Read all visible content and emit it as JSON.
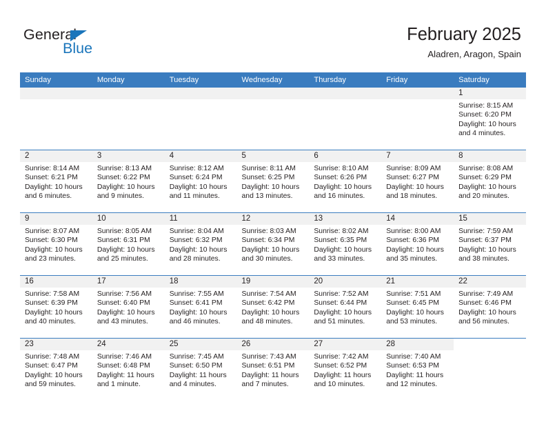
{
  "brand": {
    "name_part1": "General",
    "name_part2": "Blue"
  },
  "header": {
    "month_title": "February 2025",
    "location": "Aladren, Aragon, Spain"
  },
  "colors": {
    "header_blue": "#3a7cbf",
    "logo_blue": "#1a75bb",
    "daystrip_gray": "#f1f1f1",
    "text": "#231f20"
  },
  "weekdays": [
    "Sunday",
    "Monday",
    "Tuesday",
    "Wednesday",
    "Thursday",
    "Friday",
    "Saturday"
  ],
  "weeks": [
    [
      {
        "day": "",
        "sunrise": "",
        "sunset": "",
        "daylight_line1": "",
        "daylight_line2": "",
        "blank": true
      },
      {
        "day": "",
        "sunrise": "",
        "sunset": "",
        "daylight_line1": "",
        "daylight_line2": "",
        "blank": true
      },
      {
        "day": "",
        "sunrise": "",
        "sunset": "",
        "daylight_line1": "",
        "daylight_line2": "",
        "blank": true
      },
      {
        "day": "",
        "sunrise": "",
        "sunset": "",
        "daylight_line1": "",
        "daylight_line2": "",
        "blank": true
      },
      {
        "day": "",
        "sunrise": "",
        "sunset": "",
        "daylight_line1": "",
        "daylight_line2": "",
        "blank": true
      },
      {
        "day": "",
        "sunrise": "",
        "sunset": "",
        "daylight_line1": "",
        "daylight_line2": "",
        "blank": true
      },
      {
        "day": "1",
        "sunrise": "Sunrise: 8:15 AM",
        "sunset": "Sunset: 6:20 PM",
        "daylight_line1": "Daylight: 10 hours",
        "daylight_line2": "and 4 minutes."
      }
    ],
    [
      {
        "day": "2",
        "sunrise": "Sunrise: 8:14 AM",
        "sunset": "Sunset: 6:21 PM",
        "daylight_line1": "Daylight: 10 hours",
        "daylight_line2": "and 6 minutes."
      },
      {
        "day": "3",
        "sunrise": "Sunrise: 8:13 AM",
        "sunset": "Sunset: 6:22 PM",
        "daylight_line1": "Daylight: 10 hours",
        "daylight_line2": "and 9 minutes."
      },
      {
        "day": "4",
        "sunrise": "Sunrise: 8:12 AM",
        "sunset": "Sunset: 6:24 PM",
        "daylight_line1": "Daylight: 10 hours",
        "daylight_line2": "and 11 minutes."
      },
      {
        "day": "5",
        "sunrise": "Sunrise: 8:11 AM",
        "sunset": "Sunset: 6:25 PM",
        "daylight_line1": "Daylight: 10 hours",
        "daylight_line2": "and 13 minutes."
      },
      {
        "day": "6",
        "sunrise": "Sunrise: 8:10 AM",
        "sunset": "Sunset: 6:26 PM",
        "daylight_line1": "Daylight: 10 hours",
        "daylight_line2": "and 16 minutes."
      },
      {
        "day": "7",
        "sunrise": "Sunrise: 8:09 AM",
        "sunset": "Sunset: 6:27 PM",
        "daylight_line1": "Daylight: 10 hours",
        "daylight_line2": "and 18 minutes."
      },
      {
        "day": "8",
        "sunrise": "Sunrise: 8:08 AM",
        "sunset": "Sunset: 6:29 PM",
        "daylight_line1": "Daylight: 10 hours",
        "daylight_line2": "and 20 minutes."
      }
    ],
    [
      {
        "day": "9",
        "sunrise": "Sunrise: 8:07 AM",
        "sunset": "Sunset: 6:30 PM",
        "daylight_line1": "Daylight: 10 hours",
        "daylight_line2": "and 23 minutes."
      },
      {
        "day": "10",
        "sunrise": "Sunrise: 8:05 AM",
        "sunset": "Sunset: 6:31 PM",
        "daylight_line1": "Daylight: 10 hours",
        "daylight_line2": "and 25 minutes."
      },
      {
        "day": "11",
        "sunrise": "Sunrise: 8:04 AM",
        "sunset": "Sunset: 6:32 PM",
        "daylight_line1": "Daylight: 10 hours",
        "daylight_line2": "and 28 minutes."
      },
      {
        "day": "12",
        "sunrise": "Sunrise: 8:03 AM",
        "sunset": "Sunset: 6:34 PM",
        "daylight_line1": "Daylight: 10 hours",
        "daylight_line2": "and 30 minutes."
      },
      {
        "day": "13",
        "sunrise": "Sunrise: 8:02 AM",
        "sunset": "Sunset: 6:35 PM",
        "daylight_line1": "Daylight: 10 hours",
        "daylight_line2": "and 33 minutes."
      },
      {
        "day": "14",
        "sunrise": "Sunrise: 8:00 AM",
        "sunset": "Sunset: 6:36 PM",
        "daylight_line1": "Daylight: 10 hours",
        "daylight_line2": "and 35 minutes."
      },
      {
        "day": "15",
        "sunrise": "Sunrise: 7:59 AM",
        "sunset": "Sunset: 6:37 PM",
        "daylight_line1": "Daylight: 10 hours",
        "daylight_line2": "and 38 minutes."
      }
    ],
    [
      {
        "day": "16",
        "sunrise": "Sunrise: 7:58 AM",
        "sunset": "Sunset: 6:39 PM",
        "daylight_line1": "Daylight: 10 hours",
        "daylight_line2": "and 40 minutes."
      },
      {
        "day": "17",
        "sunrise": "Sunrise: 7:56 AM",
        "sunset": "Sunset: 6:40 PM",
        "daylight_line1": "Daylight: 10 hours",
        "daylight_line2": "and 43 minutes."
      },
      {
        "day": "18",
        "sunrise": "Sunrise: 7:55 AM",
        "sunset": "Sunset: 6:41 PM",
        "daylight_line1": "Daylight: 10 hours",
        "daylight_line2": "and 46 minutes."
      },
      {
        "day": "19",
        "sunrise": "Sunrise: 7:54 AM",
        "sunset": "Sunset: 6:42 PM",
        "daylight_line1": "Daylight: 10 hours",
        "daylight_line2": "and 48 minutes."
      },
      {
        "day": "20",
        "sunrise": "Sunrise: 7:52 AM",
        "sunset": "Sunset: 6:44 PM",
        "daylight_line1": "Daylight: 10 hours",
        "daylight_line2": "and 51 minutes."
      },
      {
        "day": "21",
        "sunrise": "Sunrise: 7:51 AM",
        "sunset": "Sunset: 6:45 PM",
        "daylight_line1": "Daylight: 10 hours",
        "daylight_line2": "and 53 minutes."
      },
      {
        "day": "22",
        "sunrise": "Sunrise: 7:49 AM",
        "sunset": "Sunset: 6:46 PM",
        "daylight_line1": "Daylight: 10 hours",
        "daylight_line2": "and 56 minutes."
      }
    ],
    [
      {
        "day": "23",
        "sunrise": "Sunrise: 7:48 AM",
        "sunset": "Sunset: 6:47 PM",
        "daylight_line1": "Daylight: 10 hours",
        "daylight_line2": "and 59 minutes."
      },
      {
        "day": "24",
        "sunrise": "Sunrise: 7:46 AM",
        "sunset": "Sunset: 6:48 PM",
        "daylight_line1": "Daylight: 11 hours",
        "daylight_line2": "and 1 minute."
      },
      {
        "day": "25",
        "sunrise": "Sunrise: 7:45 AM",
        "sunset": "Sunset: 6:50 PM",
        "daylight_line1": "Daylight: 11 hours",
        "daylight_line2": "and 4 minutes."
      },
      {
        "day": "26",
        "sunrise": "Sunrise: 7:43 AM",
        "sunset": "Sunset: 6:51 PM",
        "daylight_line1": "Daylight: 11 hours",
        "daylight_line2": "and 7 minutes."
      },
      {
        "day": "27",
        "sunrise": "Sunrise: 7:42 AM",
        "sunset": "Sunset: 6:52 PM",
        "daylight_line1": "Daylight: 11 hours",
        "daylight_line2": "and 10 minutes."
      },
      {
        "day": "28",
        "sunrise": "Sunrise: 7:40 AM",
        "sunset": "Sunset: 6:53 PM",
        "daylight_line1": "Daylight: 11 hours",
        "daylight_line2": "and 12 minutes."
      },
      {
        "day": "",
        "sunrise": "",
        "sunset": "",
        "daylight_line1": "",
        "daylight_line2": "",
        "blank": true
      }
    ]
  ]
}
